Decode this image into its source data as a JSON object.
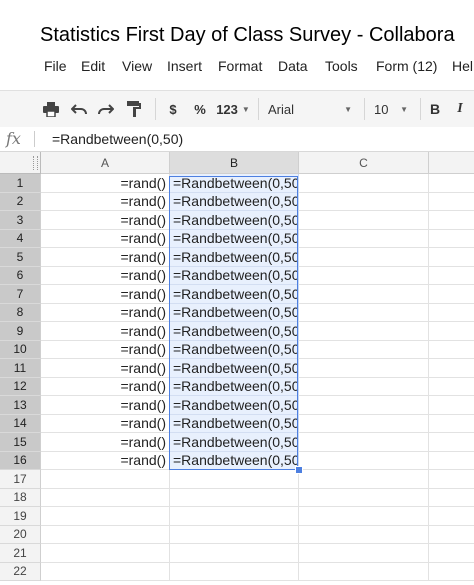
{
  "title": "Statistics First Day of Class Survey - Collabora",
  "menu": [
    "File",
    "Edit",
    "View",
    "Insert",
    "Format",
    "Data",
    "Tools",
    "Form (12)",
    "Hel"
  ],
  "toolbar": {
    "print_icon": "print-icon",
    "undo_icon": "undo-icon",
    "redo_icon": "redo-icon",
    "paint_format_icon": "paint-format-icon",
    "currency": "$",
    "percent": "%",
    "more_formats": "123",
    "font": "Arial",
    "font_size": "10",
    "bold": "B",
    "italic": "I"
  },
  "formula_bar": {
    "fx_label": "fx",
    "value": "=Randbetween(0,50)"
  },
  "columns": [
    "A",
    "B",
    "C"
  ],
  "rows": [
    {
      "num": "1",
      "a": "=rand()",
      "b": "=Randbetween(0,50"
    },
    {
      "num": "2",
      "a": "=rand()",
      "b": "=Randbetween(0,50"
    },
    {
      "num": "3",
      "a": "=rand()",
      "b": "=Randbetween(0,50"
    },
    {
      "num": "4",
      "a": "=rand()",
      "b": "=Randbetween(0,50"
    },
    {
      "num": "5",
      "a": "=rand()",
      "b": "=Randbetween(0,50"
    },
    {
      "num": "6",
      "a": "=rand()",
      "b": "=Randbetween(0,50"
    },
    {
      "num": "7",
      "a": "=rand()",
      "b": "=Randbetween(0,50"
    },
    {
      "num": "8",
      "a": "=rand()",
      "b": "=Randbetween(0,50"
    },
    {
      "num": "9",
      "a": "=rand()",
      "b": "=Randbetween(0,50"
    },
    {
      "num": "10",
      "a": "=rand()",
      "b": "=Randbetween(0,50"
    },
    {
      "num": "11",
      "a": "=rand()",
      "b": "=Randbetween(0,50"
    },
    {
      "num": "12",
      "a": "=rand()",
      "b": "=Randbetween(0,50"
    },
    {
      "num": "13",
      "a": "=rand()",
      "b": "=Randbetween(0,50"
    },
    {
      "num": "14",
      "a": "=rand()",
      "b": "=Randbetween(0,50"
    },
    {
      "num": "15",
      "a": "=rand()",
      "b": "=Randbetween(0,50"
    },
    {
      "num": "16",
      "a": "=rand()",
      "b": "=Randbetween(0,50"
    },
    {
      "num": "17",
      "a": "",
      "b": ""
    },
    {
      "num": "18",
      "a": "",
      "b": ""
    },
    {
      "num": "19",
      "a": "",
      "b": ""
    },
    {
      "num": "20",
      "a": "",
      "b": ""
    },
    {
      "num": "21",
      "a": "",
      "b": ""
    },
    {
      "num": "22",
      "a": "",
      "b": ""
    }
  ],
  "colors": {
    "selection_border": "#4d7fe0",
    "selection_fill": "#e8f0fd"
  }
}
